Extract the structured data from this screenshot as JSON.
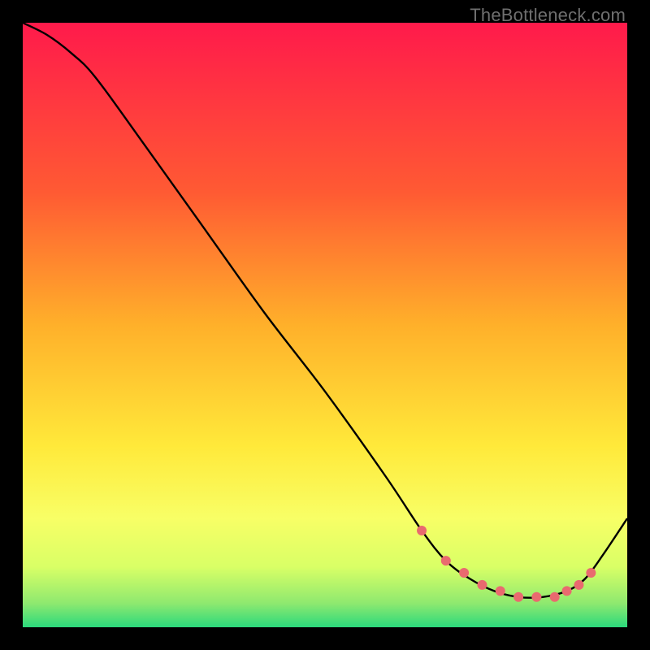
{
  "watermark": "TheBottleneck.com",
  "colors": {
    "black": "#000000",
    "curve": "#000000",
    "marker": "#e96a6f",
    "grad_top": "#ff1a4b",
    "grad_mid1": "#ff8a2a",
    "grad_mid2": "#ffe93a",
    "grad_low1": "#f8ff66",
    "grad_low2": "#d9ff66",
    "grad_bottom": "#2bd97c"
  },
  "chart_data": {
    "type": "line",
    "title": "",
    "xlabel": "",
    "ylabel": "",
    "xlim": [
      0,
      100
    ],
    "ylim": [
      0,
      100
    ],
    "series": [
      {
        "name": "bottleneck-curve",
        "x": [
          0,
          4,
          8,
          12,
          20,
          30,
          40,
          50,
          60,
          66,
          70,
          74,
          78,
          82,
          86,
          90,
          93,
          96,
          100
        ],
        "y": [
          100,
          98,
          95,
          91,
          80,
          66,
          52,
          39,
          25,
          16,
          11,
          8,
          6,
          5,
          5,
          6,
          8,
          12,
          18
        ]
      }
    ],
    "markers": {
      "name": "highlight-points",
      "x": [
        66,
        70,
        73,
        76,
        79,
        82,
        85,
        88,
        90,
        92,
        94
      ],
      "y": [
        16,
        11,
        9,
        7,
        6,
        5,
        5,
        5,
        6,
        7,
        9
      ]
    },
    "gradient_stops": [
      {
        "pos": 0.0,
        "color": "#ff1a4b"
      },
      {
        "pos": 0.28,
        "color": "#ff5a33"
      },
      {
        "pos": 0.5,
        "color": "#ffb02a"
      },
      {
        "pos": 0.7,
        "color": "#ffe93a"
      },
      {
        "pos": 0.82,
        "color": "#f8ff66"
      },
      {
        "pos": 0.9,
        "color": "#d9ff66"
      },
      {
        "pos": 0.96,
        "color": "#8fe96f"
      },
      {
        "pos": 1.0,
        "color": "#2bd97c"
      }
    ]
  }
}
